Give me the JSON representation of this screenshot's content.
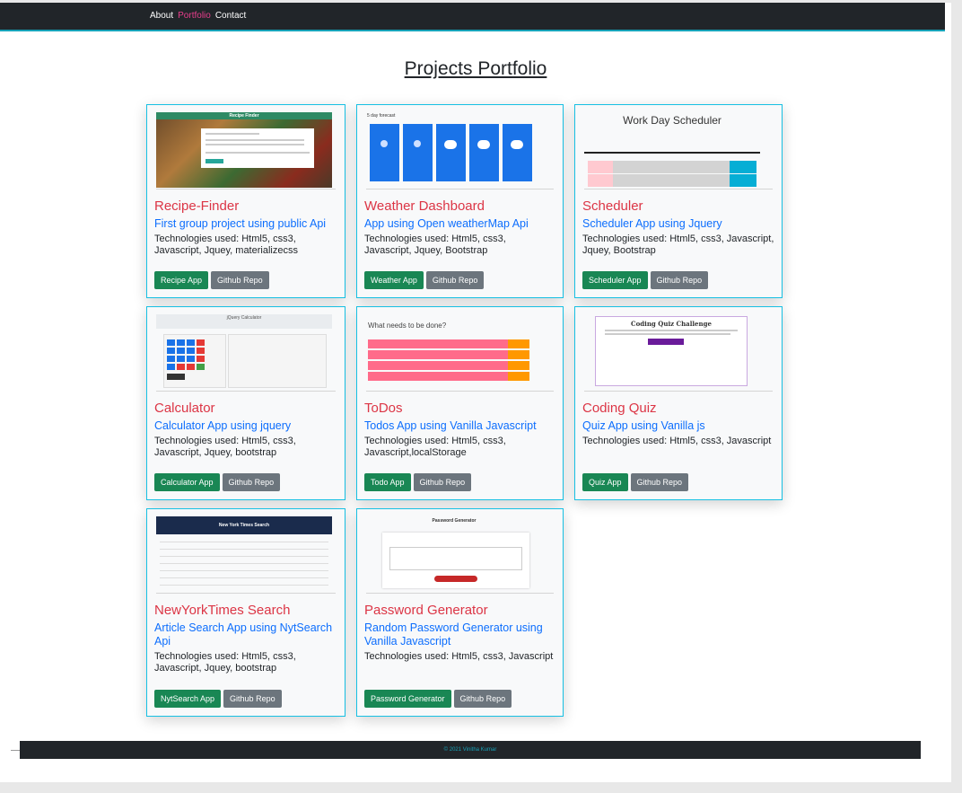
{
  "nav": {
    "links": [
      {
        "label": "About",
        "active": false
      },
      {
        "label": "Portfolio",
        "active": true
      },
      {
        "label": "Contact",
        "active": false
      }
    ]
  },
  "page": {
    "title": "Projects Portfolio"
  },
  "projects": [
    {
      "title": "Recipe-Finder",
      "subtitle": "First group project using public Api",
      "tech": "Technologies used: Html5, css3, Javascript, Jquey, materializecss",
      "app_button": "Recipe App",
      "repo_button": "Github Repo",
      "thumb": {
        "header": "Recipe Finder"
      }
    },
    {
      "title": "Weather Dashboard",
      "subtitle": "App using Open weatherMap Api",
      "tech": "Technologies used: Html5, css3, Javascript, Jquey, Bootstrap",
      "app_button": "Weather App",
      "repo_button": "Github Repo",
      "thumb": {
        "header": "5 day forecast"
      }
    },
    {
      "title": "Scheduler",
      "subtitle": "Scheduler App using Jquery",
      "tech": "Technologies used: Html5, css3, Javascript, Jquey, Bootstrap",
      "app_button": "Scheduler App",
      "repo_button": "Github Repo",
      "thumb": {
        "header": "Work Day Scheduler"
      }
    },
    {
      "title": "Calculator",
      "subtitle": "Calculator App using jquery",
      "tech": "Technologies used: Html5, css3, Javascript, Jquey, bootstrap",
      "app_button": "Calculator App",
      "repo_button": "Github Repo",
      "thumb": {
        "header": "jQuery Calculator"
      }
    },
    {
      "title": "ToDos",
      "subtitle": "Todos App using Vanilla Javascript",
      "tech": "Technologies used: Html5, css3, Javascript,localStorage",
      "app_button": "Todo App",
      "repo_button": "Github Repo",
      "thumb": {
        "header": "What needs to be done?"
      }
    },
    {
      "title": "Coding Quiz",
      "subtitle": "Quiz App using Vanilla js",
      "tech": "Technologies used: Html5, css3, Javascript",
      "app_button": "Quiz App",
      "repo_button": "Github Repo",
      "thumb": {
        "header": "Coding Quiz Challenge"
      }
    },
    {
      "title": "NewYorkTimes Search",
      "subtitle": "Article Search App using NytSearch Api",
      "tech": "Technologies used: Html5, css3, Javascript, Jquey, bootstrap",
      "app_button": "NytSearch App",
      "repo_button": "Github Repo",
      "thumb": {
        "header": "New York Times Search"
      }
    },
    {
      "title": "Password Generator",
      "subtitle": "Random Password Generator using Vanilla Javascript",
      "tech": "Technologies used: Html5, css3, Javascript",
      "app_button": "Password Generator",
      "repo_button": "Github Repo",
      "thumb": {
        "header": "Password Generator"
      }
    }
  ],
  "footer": {
    "text": "© 2021 Vinitha Kumar"
  },
  "colors": {
    "navbar": "#212529",
    "active_link": "#e83e8c",
    "card_border": "#17c0e3",
    "title_red": "#dc3545",
    "subtitle_blue": "#0d6efd",
    "button_green": "#198754",
    "button_grey": "#6c757d"
  }
}
